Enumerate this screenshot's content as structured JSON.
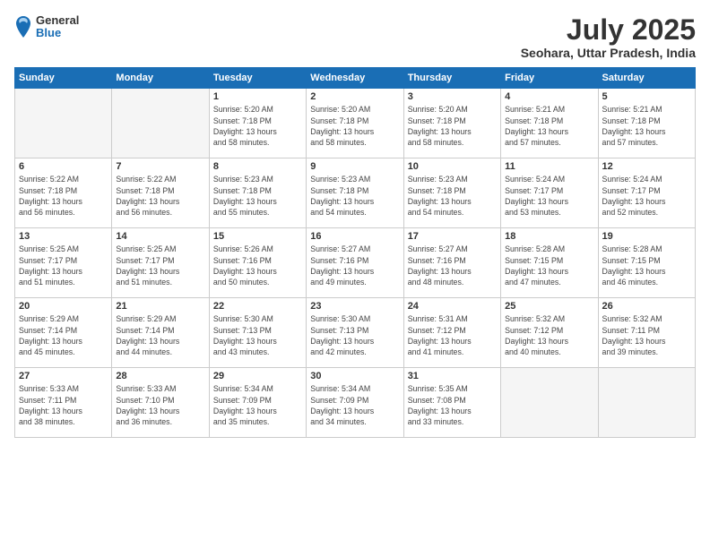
{
  "logo": {
    "general": "General",
    "blue": "Blue"
  },
  "title": "July 2025",
  "location": "Seohara, Uttar Pradesh, India",
  "days_of_week": [
    "Sunday",
    "Monday",
    "Tuesday",
    "Wednesday",
    "Thursday",
    "Friday",
    "Saturday"
  ],
  "weeks": [
    [
      {
        "day": "",
        "info": ""
      },
      {
        "day": "",
        "info": ""
      },
      {
        "day": "1",
        "info": "Sunrise: 5:20 AM\nSunset: 7:18 PM\nDaylight: 13 hours\nand 58 minutes."
      },
      {
        "day": "2",
        "info": "Sunrise: 5:20 AM\nSunset: 7:18 PM\nDaylight: 13 hours\nand 58 minutes."
      },
      {
        "day": "3",
        "info": "Sunrise: 5:20 AM\nSunset: 7:18 PM\nDaylight: 13 hours\nand 58 minutes."
      },
      {
        "day": "4",
        "info": "Sunrise: 5:21 AM\nSunset: 7:18 PM\nDaylight: 13 hours\nand 57 minutes."
      },
      {
        "day": "5",
        "info": "Sunrise: 5:21 AM\nSunset: 7:18 PM\nDaylight: 13 hours\nand 57 minutes."
      }
    ],
    [
      {
        "day": "6",
        "info": "Sunrise: 5:22 AM\nSunset: 7:18 PM\nDaylight: 13 hours\nand 56 minutes."
      },
      {
        "day": "7",
        "info": "Sunrise: 5:22 AM\nSunset: 7:18 PM\nDaylight: 13 hours\nand 56 minutes."
      },
      {
        "day": "8",
        "info": "Sunrise: 5:23 AM\nSunset: 7:18 PM\nDaylight: 13 hours\nand 55 minutes."
      },
      {
        "day": "9",
        "info": "Sunrise: 5:23 AM\nSunset: 7:18 PM\nDaylight: 13 hours\nand 54 minutes."
      },
      {
        "day": "10",
        "info": "Sunrise: 5:23 AM\nSunset: 7:18 PM\nDaylight: 13 hours\nand 54 minutes."
      },
      {
        "day": "11",
        "info": "Sunrise: 5:24 AM\nSunset: 7:17 PM\nDaylight: 13 hours\nand 53 minutes."
      },
      {
        "day": "12",
        "info": "Sunrise: 5:24 AM\nSunset: 7:17 PM\nDaylight: 13 hours\nand 52 minutes."
      }
    ],
    [
      {
        "day": "13",
        "info": "Sunrise: 5:25 AM\nSunset: 7:17 PM\nDaylight: 13 hours\nand 51 minutes."
      },
      {
        "day": "14",
        "info": "Sunrise: 5:25 AM\nSunset: 7:17 PM\nDaylight: 13 hours\nand 51 minutes."
      },
      {
        "day": "15",
        "info": "Sunrise: 5:26 AM\nSunset: 7:16 PM\nDaylight: 13 hours\nand 50 minutes."
      },
      {
        "day": "16",
        "info": "Sunrise: 5:27 AM\nSunset: 7:16 PM\nDaylight: 13 hours\nand 49 minutes."
      },
      {
        "day": "17",
        "info": "Sunrise: 5:27 AM\nSunset: 7:16 PM\nDaylight: 13 hours\nand 48 minutes."
      },
      {
        "day": "18",
        "info": "Sunrise: 5:28 AM\nSunset: 7:15 PM\nDaylight: 13 hours\nand 47 minutes."
      },
      {
        "day": "19",
        "info": "Sunrise: 5:28 AM\nSunset: 7:15 PM\nDaylight: 13 hours\nand 46 minutes."
      }
    ],
    [
      {
        "day": "20",
        "info": "Sunrise: 5:29 AM\nSunset: 7:14 PM\nDaylight: 13 hours\nand 45 minutes."
      },
      {
        "day": "21",
        "info": "Sunrise: 5:29 AM\nSunset: 7:14 PM\nDaylight: 13 hours\nand 44 minutes."
      },
      {
        "day": "22",
        "info": "Sunrise: 5:30 AM\nSunset: 7:13 PM\nDaylight: 13 hours\nand 43 minutes."
      },
      {
        "day": "23",
        "info": "Sunrise: 5:30 AM\nSunset: 7:13 PM\nDaylight: 13 hours\nand 42 minutes."
      },
      {
        "day": "24",
        "info": "Sunrise: 5:31 AM\nSunset: 7:12 PM\nDaylight: 13 hours\nand 41 minutes."
      },
      {
        "day": "25",
        "info": "Sunrise: 5:32 AM\nSunset: 7:12 PM\nDaylight: 13 hours\nand 40 minutes."
      },
      {
        "day": "26",
        "info": "Sunrise: 5:32 AM\nSunset: 7:11 PM\nDaylight: 13 hours\nand 39 minutes."
      }
    ],
    [
      {
        "day": "27",
        "info": "Sunrise: 5:33 AM\nSunset: 7:11 PM\nDaylight: 13 hours\nand 38 minutes."
      },
      {
        "day": "28",
        "info": "Sunrise: 5:33 AM\nSunset: 7:10 PM\nDaylight: 13 hours\nand 36 minutes."
      },
      {
        "day": "29",
        "info": "Sunrise: 5:34 AM\nSunset: 7:09 PM\nDaylight: 13 hours\nand 35 minutes."
      },
      {
        "day": "30",
        "info": "Sunrise: 5:34 AM\nSunset: 7:09 PM\nDaylight: 13 hours\nand 34 minutes."
      },
      {
        "day": "31",
        "info": "Sunrise: 5:35 AM\nSunset: 7:08 PM\nDaylight: 13 hours\nand 33 minutes."
      },
      {
        "day": "",
        "info": ""
      },
      {
        "day": "",
        "info": ""
      }
    ]
  ]
}
